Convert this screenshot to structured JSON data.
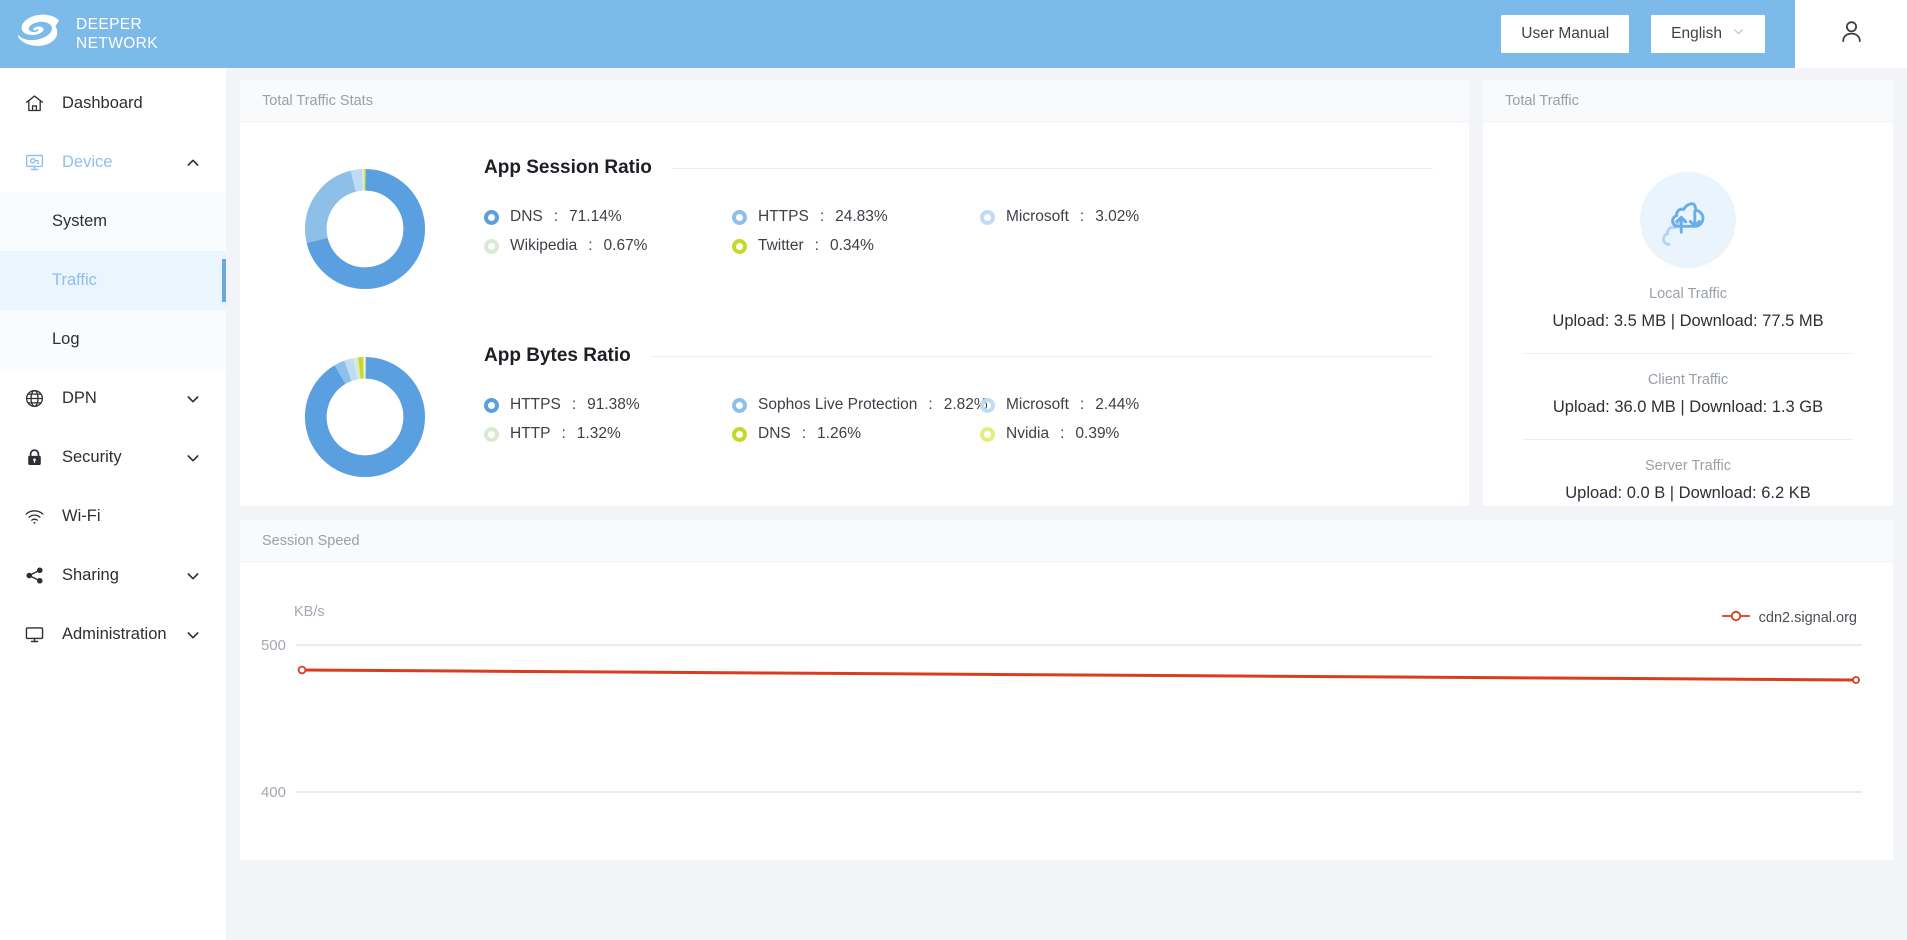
{
  "brand": {
    "line1": "DEEPER",
    "line2": "NETWORK",
    "logo_icon": "deeper-spiral-logo"
  },
  "header": {
    "user_manual_label": "User Manual",
    "language_label": "English",
    "language_caret_icon": "chevron-down-icon",
    "account_icon": "user-avatar-icon"
  },
  "sidebar": {
    "items": [
      {
        "label": "Dashboard",
        "icon": "home-icon",
        "chevron": "",
        "state": "normal"
      },
      {
        "label": "Device",
        "icon": "device-monitor-icon",
        "chevron": "chevron-up-icon",
        "state": "expanded"
      },
      {
        "label": "DPN",
        "icon": "globe-icon",
        "chevron": "chevron-down-icon",
        "state": "normal"
      },
      {
        "label": "Security",
        "icon": "lock-icon",
        "chevron": "chevron-down-icon",
        "state": "normal"
      },
      {
        "label": "Wi-Fi",
        "icon": "wifi-icon",
        "chevron": "",
        "state": "normal"
      },
      {
        "label": "Sharing",
        "icon": "share-nodes-icon",
        "chevron": "chevron-down-icon",
        "state": "normal"
      },
      {
        "label": "Administration",
        "icon": "desktop-icon",
        "chevron": "chevron-down-icon",
        "state": "normal"
      }
    ],
    "subitems": [
      {
        "label": "System",
        "active": false
      },
      {
        "label": "Traffic",
        "active": true
      },
      {
        "label": "Log",
        "active": false
      }
    ]
  },
  "stats_panel": {
    "title": "Total Traffic Stats",
    "session": {
      "title": "App Session Ratio",
      "legend": [
        {
          "name": "DNS",
          "value": "71.14%",
          "color": "#5a9fe0"
        },
        {
          "name": "HTTPS",
          "value": "24.83%",
          "color": "#8ebfe9"
        },
        {
          "name": "Microsoft",
          "value": "3.02%",
          "color": "#bedcf5"
        },
        {
          "name": "Wikipedia",
          "value": "0.67%",
          "color": "#d9ead3"
        },
        {
          "name": "Twitter",
          "value": "0.34%",
          "color": "#c6d92b"
        }
      ]
    },
    "bytes": {
      "title": "App Bytes Ratio",
      "legend": [
        {
          "name": "HTTPS",
          "value": "91.38%",
          "color": "#5a9fe0"
        },
        {
          "name": "Sophos Live Protection",
          "value": "2.82%",
          "color": "#8ebfe9"
        },
        {
          "name": "Microsoft",
          "value": "2.44%",
          "color": "#bedcf5"
        },
        {
          "name": "HTTP",
          "value": "1.32%",
          "color": "#d9ead3"
        },
        {
          "name": "DNS",
          "value": "1.26%",
          "color": "#c6d92b"
        },
        {
          "name": "Nvidia",
          "value": "0.39%",
          "color": "#e3ef7c"
        }
      ]
    }
  },
  "total_traffic": {
    "title": "Total Traffic",
    "cloud_icon": "cloud-upload-download-icon",
    "sections": [
      {
        "label": "Local Traffic",
        "value": "Upload: 3.5 MB | Download: 77.5 MB"
      },
      {
        "label": "Client Traffic",
        "value": "Upload: 36.0 MB | Download: 1.3 GB"
      },
      {
        "label": "Server Traffic",
        "value": "Upload: 0.0 B | Download: 6.2 KB"
      }
    ]
  },
  "session_speed": {
    "title": "Session Speed",
    "legend_label": "cdn2.signal.org",
    "legend_marker_icon": "line-circle-marker-icon",
    "legend_color": "#d93c1e"
  },
  "chart_data": {
    "type": "line",
    "title": "Session Speed",
    "ylabel": "KB/s",
    "xlabel": "",
    "ylim": [
      400,
      500
    ],
    "yticks": [
      400,
      500
    ],
    "grid": true,
    "legend_position": "top-right",
    "series": [
      {
        "name": "cdn2.signal.org",
        "color": "#d93c1e",
        "x": [
          0,
          1,
          2,
          3,
          4,
          5,
          6,
          7,
          8,
          9,
          10
        ],
        "values": [
          482,
          481,
          481,
          480,
          480,
          479,
          479,
          478,
          478,
          477,
          477
        ]
      }
    ]
  }
}
